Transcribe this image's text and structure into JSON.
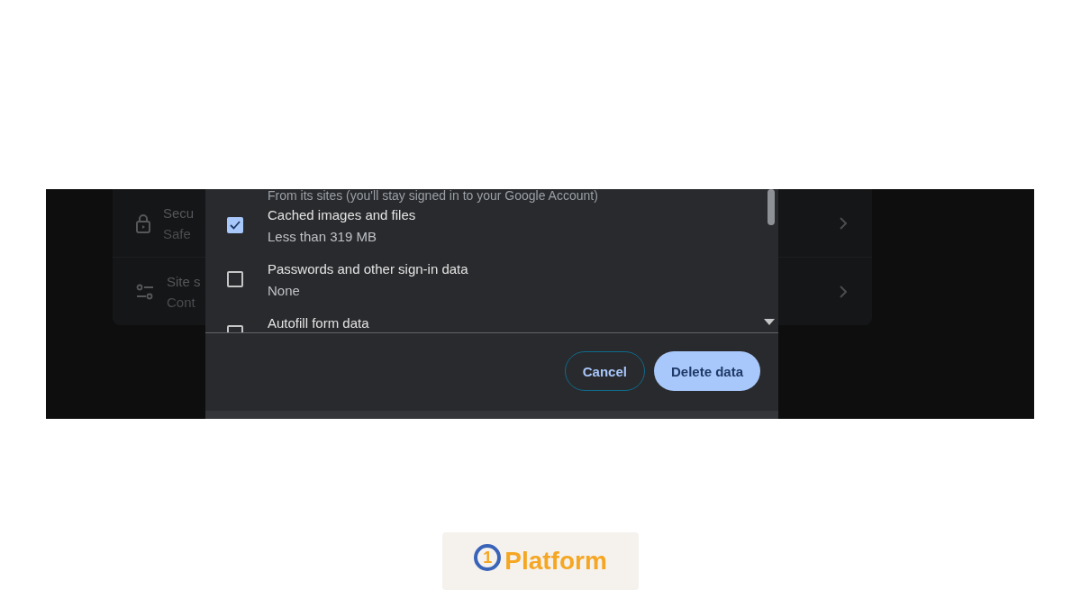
{
  "background_settings": [
    {
      "title": "Secu",
      "subtitle": "Safe",
      "kind": "lock"
    },
    {
      "title": "Site s",
      "subtitle": "Cont",
      "kind": "sliders"
    }
  ],
  "dialog": {
    "cut_text": "From its sites (you'll stay signed in to your Google Account)",
    "options": [
      {
        "label": "Cached images and files",
        "detail": "Less than 319 MB",
        "checked": true
      },
      {
        "label": "Passwords and other sign-in data",
        "detail": "None",
        "checked": false
      },
      {
        "label": "Autofill form data",
        "checked": false
      }
    ],
    "buttons": [
      {
        "label": "Cancel",
        "kind": "outlined"
      },
      {
        "label": "Delete data",
        "kind": "filled"
      }
    ]
  },
  "logo": {
    "mark": "1",
    "name": "Platform"
  }
}
